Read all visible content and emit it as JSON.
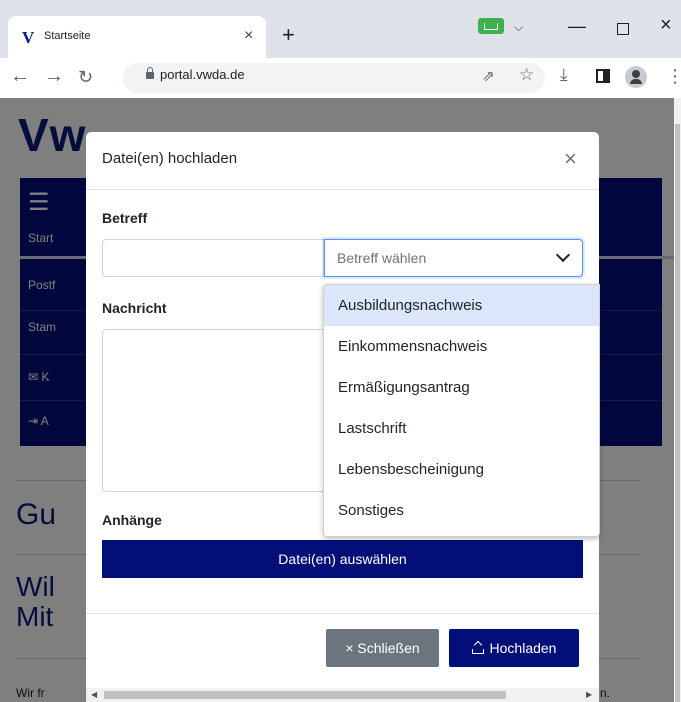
{
  "browser": {
    "tab_title": "Startseite",
    "tab_favicon": "V",
    "url": "portal.vwda.de",
    "icons": [
      "back-icon",
      "forward-icon",
      "reload-icon",
      "lock-icon",
      "share-icon",
      "star-icon",
      "download-icon",
      "side-panel-icon",
      "profile-icon",
      "menu-icon"
    ]
  },
  "page": {
    "logo_fragment": "Vw",
    "nav": [
      "Start",
      "Postf",
      "Stam",
      "K",
      "A"
    ],
    "heading_1": "Gu",
    "heading_2_line1": "Wil",
    "heading_2_line2": "Mit",
    "body_text": "Wir fr",
    "body_text_end": "n."
  },
  "modal": {
    "title": "Datei(en) hochladen",
    "close_glyph": "×",
    "subject_label": "Betreff",
    "subject_placeholder": "Betreff wählen",
    "message_label": "Nachricht",
    "attachments_label": "Anhänge",
    "choose_files_label": "Datei(en) auswählen",
    "close_button_label": "× Schließen",
    "upload_button_label": "Hochladen"
  },
  "subject_options": [
    "Ausbildungsnachweis",
    "Einkommensnachweis",
    "Ermäßigungsantrag",
    "Lastschrift",
    "Lebensbescheinigung",
    "Sonstiges"
  ],
  "colors": {
    "brand_navy": "#030f78",
    "secondary_gray": "#6c757d",
    "option_highlight": "#dbe6fb"
  }
}
